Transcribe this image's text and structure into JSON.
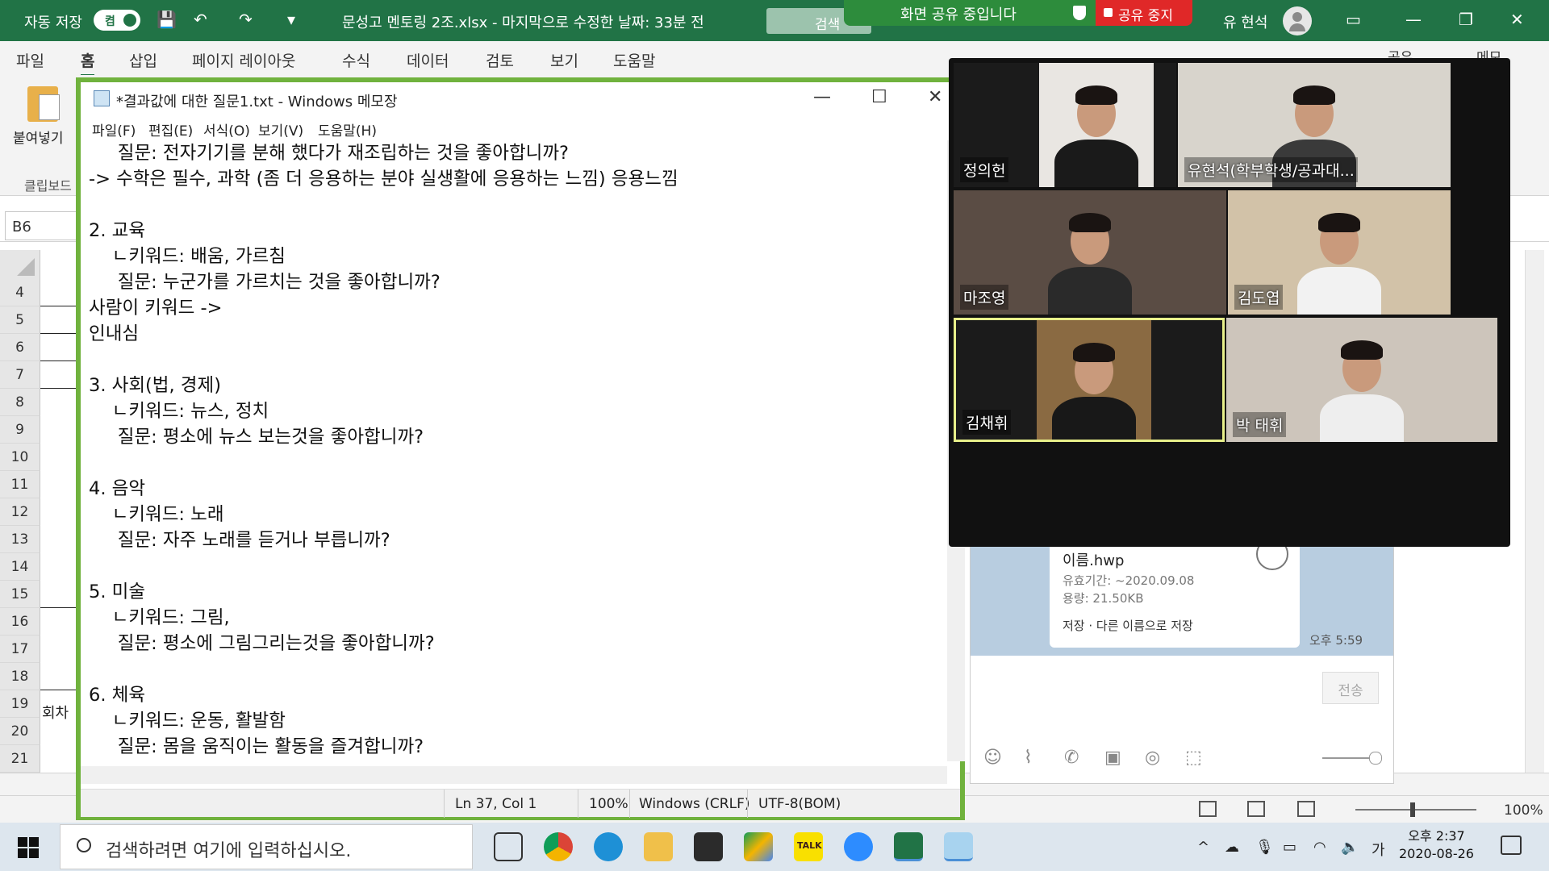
{
  "excel": {
    "autosave_label": "자동 저장",
    "autosave_state": "켬",
    "doc_title": "문성고 멘토링 2조.xlsx - 마지막으로 수정한 날짜: 33분 전",
    "search_label": "검색",
    "user_name": "유 현석",
    "tabs": [
      "파일",
      "홈",
      "삽입",
      "페이지 레이아웃",
      "수식",
      "데이터",
      "검토",
      "보기",
      "도움말"
    ],
    "active_tab": "홈",
    "share_label": "공유",
    "memo_label": "메모",
    "paste_label": "붙여넣기",
    "clipboard_label": "클립보드",
    "name_box": "B6",
    "rows": [
      "4",
      "5",
      "6",
      "7",
      "8",
      "9",
      "10",
      "11",
      "12",
      "13",
      "14",
      "15",
      "16",
      "17",
      "18",
      "19",
      "20",
      "21"
    ],
    "cell_a19": "회차",
    "zoom": "100%"
  },
  "share_banner": {
    "message": "화면 공유 중입니다",
    "stop_label": "공유 중지"
  },
  "notepad": {
    "title": "*결과값에 대한 질문1.txt - Windows 메모장",
    "menu": [
      "파일(F)",
      "편집(E)",
      "서식(O)",
      "보기(V)",
      "도움말(H)"
    ],
    "lines": [
      "     질문: 전자기기를 분해 했다가 재조립하는 것을 좋아합니까?",
      "-> 수학은 필수, 과학 (좀 더 응용하는 분야 실생활에 응용하는 느낌) 응용느낌",
      "",
      "2. 교육",
      "    ㄴ키워드: 배움, 가르침",
      "     질문: 누군가를 가르치는 것을 좋아합니까?",
      "사람이 키워드 ->",
      "인내심",
      "",
      "3. 사회(법, 경제)",
      "    ㄴ키워드: 뉴스, 정치",
      "     질문: 평소에 뉴스 보는것을 좋아합니까?",
      "",
      "4. 음악",
      "    ㄴ키워드: 노래",
      "     질문: 자주 노래를 듣거나 부릅니까?",
      "",
      "5. 미술",
      "    ㄴ키워드: 그림,",
      "     질문: 평소에 그림그리는것을 좋아합니까?",
      "",
      "6. 체육",
      "    ㄴ키워드: 운동, 활발함",
      "     질문: 몸을 움직이는 활동을 즐겨합니까?"
    ],
    "status": {
      "position": "Ln 37, Col 1",
      "zoom": "100%",
      "line_ending": "Windows (CRLF)",
      "encoding": "UTF-8(BOM)"
    }
  },
  "video_call": {
    "participants": [
      {
        "name": "정의헌",
        "shirt": "#1a1a1a",
        "bg": "#e9e6e2"
      },
      {
        "name": "유현석(학부학생/공과대...",
        "shirt": "#3a3a3a",
        "bg": "#d8d4cc"
      },
      {
        "name": "마조영",
        "shirt": "#2a2a2a",
        "bg": "#5a4c44"
      },
      {
        "name": "김도엽",
        "shirt": "#f2f2f2",
        "bg": "#d2c2a8"
      },
      {
        "name": "김채휘",
        "shirt": "#181818",
        "bg": "#8a6a42"
      },
      {
        "name": "박 태휘",
        "shirt": "#eeeeee",
        "bg": "#cdc5bb"
      }
    ],
    "active_speaker": "김채휘"
  },
  "chat": {
    "file_name": "이름.hwp",
    "expiry": "유효기간: ~2020.09.08",
    "size": "용량: 21.50KB",
    "actions": "저장 · 다른 이름으로 저장",
    "time": "오후 5:59",
    "send_label": "전송"
  },
  "taskbar": {
    "search_placeholder": "검색하려면 여기에 입력하십시오.",
    "ime": "가",
    "time": "오후 2:37",
    "date": "2020-08-26",
    "apps": [
      "task-view",
      "chrome",
      "internet-explorer",
      "file-explorer",
      "microsoft-store",
      "google-drive",
      "kakaotalk",
      "zoom",
      "excel",
      "notepad"
    ],
    "kakao_label": "TALK"
  }
}
